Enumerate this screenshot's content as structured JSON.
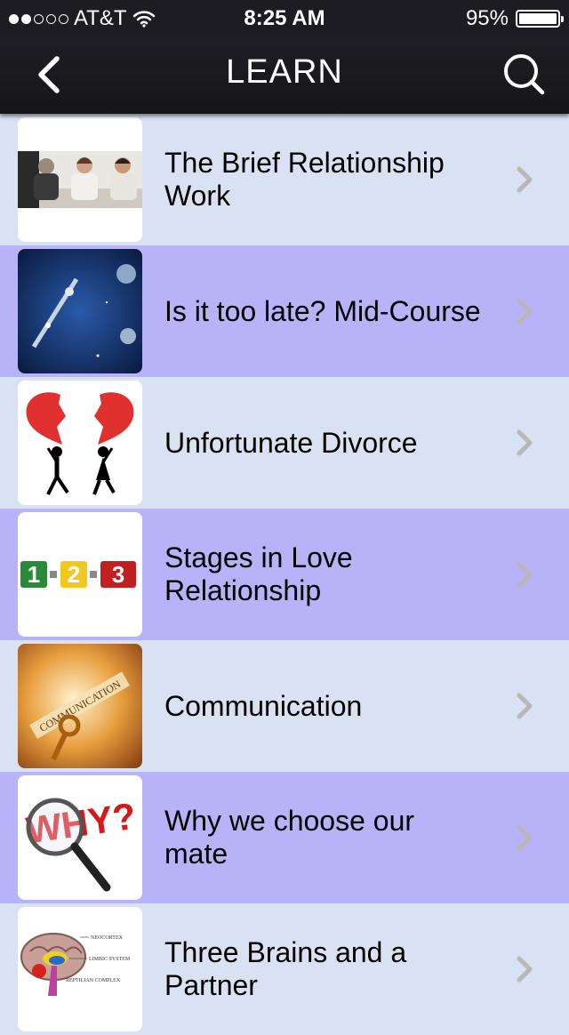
{
  "status": {
    "carrier": "AT&T",
    "time": "8:25 AM",
    "battery": "95%",
    "battery_level": 0.95
  },
  "nav": {
    "title": "LEARN",
    "back_icon": "chevron-left-icon",
    "search_icon": "search-icon"
  },
  "items": [
    {
      "label": "The Brief Relationship Work",
      "thumb": "people-photo"
    },
    {
      "label": "Is it too late?  Mid-Course",
      "thumb": "space-photo"
    },
    {
      "label": "Unfortunate Divorce",
      "thumb": "broken-heart-illustration"
    },
    {
      "label": "Stages in Love Relationship",
      "thumb": "one-two-three-graphic"
    },
    {
      "label": "Communication",
      "thumb": "key-communication-photo"
    },
    {
      "label": "Why we choose our mate",
      "thumb": "why-magnifier-graphic"
    },
    {
      "label": "Three Brains and a Partner",
      "thumb": "brain-diagram"
    }
  ],
  "brain_labels": [
    "NEOCORTEX",
    "LIMBIC SYSTEM",
    "REPTILIAN COMPLEX"
  ],
  "key_text": "COMMUNICATION",
  "why_text": "WHY?",
  "numbers": [
    "1",
    "2",
    "3"
  ],
  "colors": {
    "row_blue": "#d8e2f2",
    "row_purple": "#b8b2f8",
    "nav_bg": "#1c1c22"
  }
}
